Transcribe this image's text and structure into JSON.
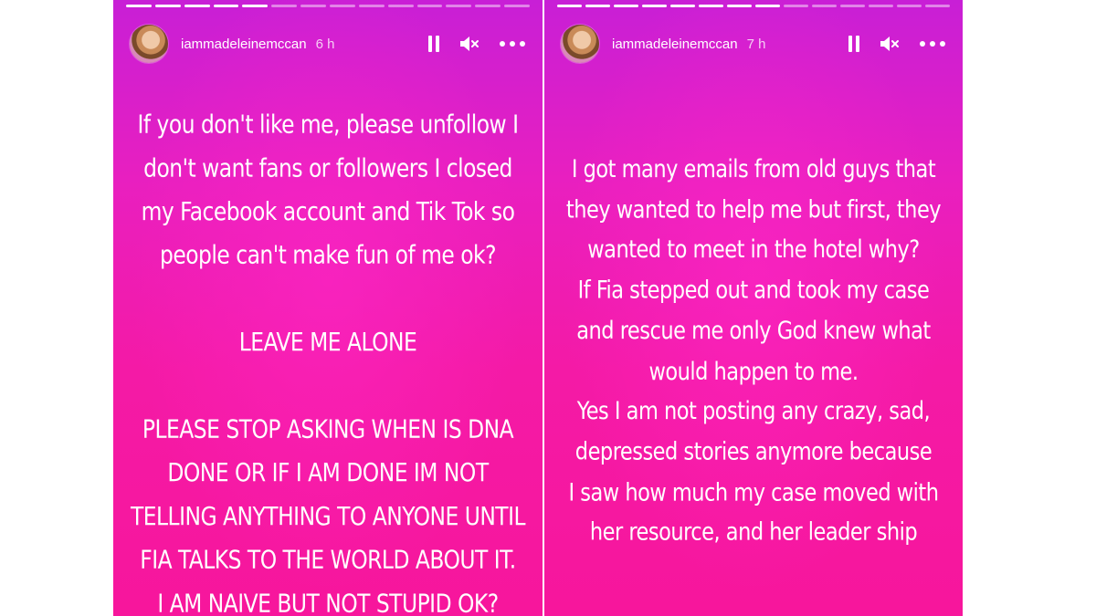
{
  "stories": [
    {
      "username": "iammadeleinemccan",
      "time": "6 h",
      "lines": [
        "If you don't like me, please unfollow I",
        "don't want fans or followers I closed",
        "my Facebook account and Tik Tok so",
        "people can't make fun of me ok?",
        "",
        "LEAVE ME ALONE",
        "",
        "PLEASE STOP ASKING WHEN IS DNA",
        "DONE OR IF I AM DONE IM NOT",
        "TELLING ANYTHING TO ANYONE UNTIL",
        "FIA TALKS TO THE WORLD ABOUT IT.",
        "I AM NAIVE BUT NOT STUPID OK?"
      ]
    },
    {
      "username": "iammadeleinemccan",
      "time": "7 h",
      "lines": [
        "I got many emails from old guys that",
        "they wanted to help me but first, they",
        "wanted to meet in the hotel why?",
        "If Fia stepped out and took my case",
        "and rescue me only God knew what",
        "would happen to me.",
        "Yes I am not posting any crazy, sad,",
        "depressed stories anymore because",
        "I saw how much my case moved with",
        "her resource, and her leader ship"
      ]
    }
  ],
  "icons": {
    "pause": "pause-icon",
    "mute": "speaker-muted-icon",
    "more": "more-options-icon"
  },
  "colors": {
    "gradient_top": "#c81fd6",
    "gradient_bottom": "#f7169c",
    "text": "#ffffff"
  }
}
